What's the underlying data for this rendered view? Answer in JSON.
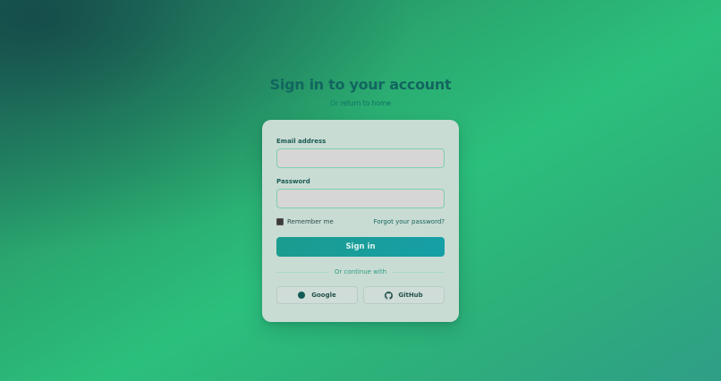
{
  "header": {
    "title": "Sign in to your account",
    "subtitle_prefix": "Or ",
    "return_link": "return to home"
  },
  "form": {
    "email_label": "Email address",
    "email_value": "",
    "password_label": "Password",
    "password_value": "",
    "remember_label": "Remember me",
    "remember_checked": true,
    "forgot_link": "Forgot your password?",
    "signin_label": "Sign in",
    "divider_text": "Or continue with"
  },
  "social": {
    "google_label": "Google",
    "google_icon": "google-icon",
    "github_label": "GitHub",
    "github_icon": "github-icon"
  },
  "colors": {
    "title": "#12665f",
    "button_start": "#1b9c8f",
    "button_end": "#169fa6",
    "input_border": "#7ccfae",
    "card_bg": "#c9dcd4"
  }
}
